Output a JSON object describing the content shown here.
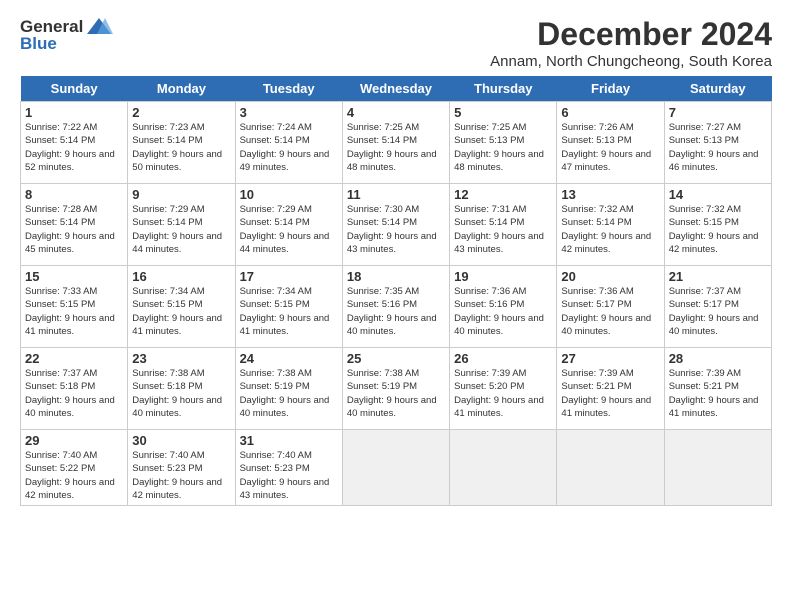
{
  "logo": {
    "general": "General",
    "blue": "Blue"
  },
  "title": "December 2024",
  "subtitle": "Annam, North Chungcheong, South Korea",
  "days_of_week": [
    "Sunday",
    "Monday",
    "Tuesday",
    "Wednesday",
    "Thursday",
    "Friday",
    "Saturday"
  ],
  "weeks": [
    [
      {
        "num": "1",
        "sunrise": "7:22 AM",
        "sunset": "5:14 PM",
        "daylight": "9 hours and 52 minutes."
      },
      {
        "num": "2",
        "sunrise": "7:23 AM",
        "sunset": "5:14 PM",
        "daylight": "9 hours and 50 minutes."
      },
      {
        "num": "3",
        "sunrise": "7:24 AM",
        "sunset": "5:14 PM",
        "daylight": "9 hours and 49 minutes."
      },
      {
        "num": "4",
        "sunrise": "7:25 AM",
        "sunset": "5:14 PM",
        "daylight": "9 hours and 48 minutes."
      },
      {
        "num": "5",
        "sunrise": "7:25 AM",
        "sunset": "5:13 PM",
        "daylight": "9 hours and 48 minutes."
      },
      {
        "num": "6",
        "sunrise": "7:26 AM",
        "sunset": "5:13 PM",
        "daylight": "9 hours and 47 minutes."
      },
      {
        "num": "7",
        "sunrise": "7:27 AM",
        "sunset": "5:13 PM",
        "daylight": "9 hours and 46 minutes."
      }
    ],
    [
      {
        "num": "8",
        "sunrise": "7:28 AM",
        "sunset": "5:14 PM",
        "daylight": "9 hours and 45 minutes."
      },
      {
        "num": "9",
        "sunrise": "7:29 AM",
        "sunset": "5:14 PM",
        "daylight": "9 hours and 44 minutes."
      },
      {
        "num": "10",
        "sunrise": "7:29 AM",
        "sunset": "5:14 PM",
        "daylight": "9 hours and 44 minutes."
      },
      {
        "num": "11",
        "sunrise": "7:30 AM",
        "sunset": "5:14 PM",
        "daylight": "9 hours and 43 minutes."
      },
      {
        "num": "12",
        "sunrise": "7:31 AM",
        "sunset": "5:14 PM",
        "daylight": "9 hours and 43 minutes."
      },
      {
        "num": "13",
        "sunrise": "7:32 AM",
        "sunset": "5:14 PM",
        "daylight": "9 hours and 42 minutes."
      },
      {
        "num": "14",
        "sunrise": "7:32 AM",
        "sunset": "5:15 PM",
        "daylight": "9 hours and 42 minutes."
      }
    ],
    [
      {
        "num": "15",
        "sunrise": "7:33 AM",
        "sunset": "5:15 PM",
        "daylight": "9 hours and 41 minutes."
      },
      {
        "num": "16",
        "sunrise": "7:34 AM",
        "sunset": "5:15 PM",
        "daylight": "9 hours and 41 minutes."
      },
      {
        "num": "17",
        "sunrise": "7:34 AM",
        "sunset": "5:15 PM",
        "daylight": "9 hours and 41 minutes."
      },
      {
        "num": "18",
        "sunrise": "7:35 AM",
        "sunset": "5:16 PM",
        "daylight": "9 hours and 40 minutes."
      },
      {
        "num": "19",
        "sunrise": "7:36 AM",
        "sunset": "5:16 PM",
        "daylight": "9 hours and 40 minutes."
      },
      {
        "num": "20",
        "sunrise": "7:36 AM",
        "sunset": "5:17 PM",
        "daylight": "9 hours and 40 minutes."
      },
      {
        "num": "21",
        "sunrise": "7:37 AM",
        "sunset": "5:17 PM",
        "daylight": "9 hours and 40 minutes."
      }
    ],
    [
      {
        "num": "22",
        "sunrise": "7:37 AM",
        "sunset": "5:18 PM",
        "daylight": "9 hours and 40 minutes."
      },
      {
        "num": "23",
        "sunrise": "7:38 AM",
        "sunset": "5:18 PM",
        "daylight": "9 hours and 40 minutes."
      },
      {
        "num": "24",
        "sunrise": "7:38 AM",
        "sunset": "5:19 PM",
        "daylight": "9 hours and 40 minutes."
      },
      {
        "num": "25",
        "sunrise": "7:38 AM",
        "sunset": "5:19 PM",
        "daylight": "9 hours and 40 minutes."
      },
      {
        "num": "26",
        "sunrise": "7:39 AM",
        "sunset": "5:20 PM",
        "daylight": "9 hours and 41 minutes."
      },
      {
        "num": "27",
        "sunrise": "7:39 AM",
        "sunset": "5:21 PM",
        "daylight": "9 hours and 41 minutes."
      },
      {
        "num": "28",
        "sunrise": "7:39 AM",
        "sunset": "5:21 PM",
        "daylight": "9 hours and 41 minutes."
      }
    ],
    [
      {
        "num": "29",
        "sunrise": "7:40 AM",
        "sunset": "5:22 PM",
        "daylight": "9 hours and 42 minutes."
      },
      {
        "num": "30",
        "sunrise": "7:40 AM",
        "sunset": "5:23 PM",
        "daylight": "9 hours and 42 minutes."
      },
      {
        "num": "31",
        "sunrise": "7:40 AM",
        "sunset": "5:23 PM",
        "daylight": "9 hours and 43 minutes."
      },
      null,
      null,
      null,
      null
    ]
  ]
}
